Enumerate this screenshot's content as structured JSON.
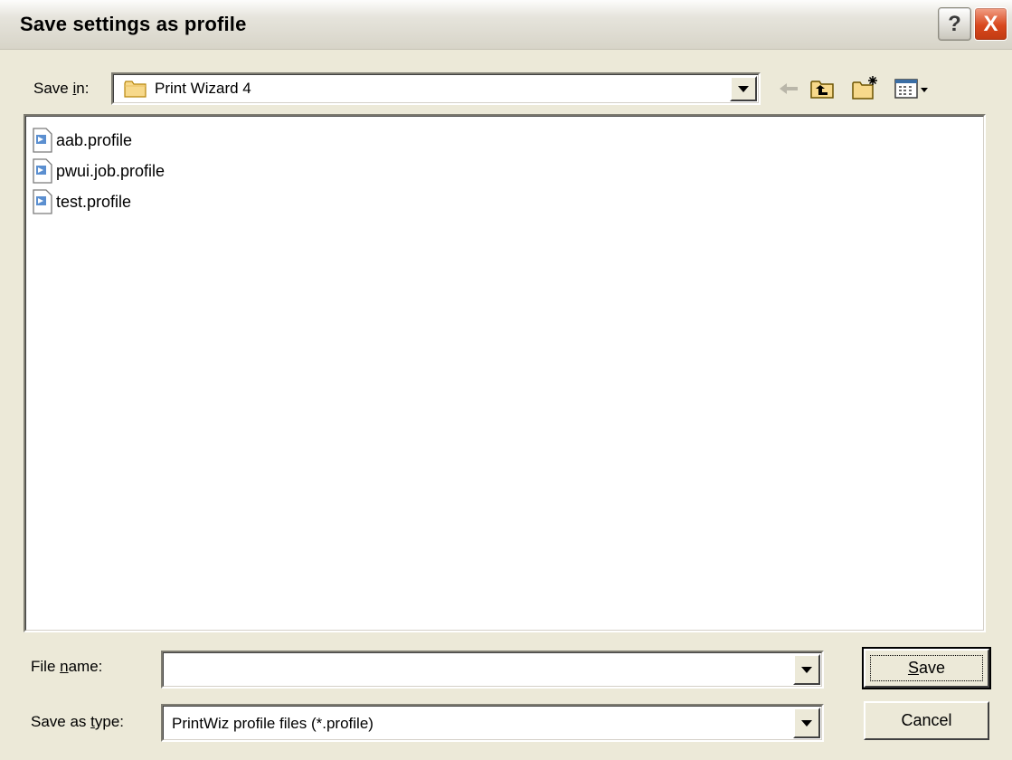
{
  "dialog": {
    "title": "Save settings as profile",
    "help_glyph": "?",
    "close_glyph": "X"
  },
  "save_in": {
    "label_prefix": "Save ",
    "label_accel": "i",
    "label_suffix": "n:",
    "value": "Print Wizard 4",
    "folder_icon": "folder-icon"
  },
  "toolbar": {
    "back_icon": "back-arrow-icon",
    "up_icon": "up-one-level-icon",
    "new_folder_icon": "new-folder-icon",
    "view_icon": "view-menu-icon"
  },
  "files": [
    {
      "name": "aab.profile",
      "icon": "profile-file-icon"
    },
    {
      "name": "pwui.job.profile",
      "icon": "profile-file-icon"
    },
    {
      "name": "test.profile",
      "icon": "profile-file-icon"
    }
  ],
  "file_name": {
    "label_prefix": "File ",
    "label_accel": "n",
    "label_suffix": "ame:",
    "value": ""
  },
  "save_as_type": {
    "label_prefix": "Save as ",
    "label_accel": "t",
    "label_suffix": "ype:",
    "value": "PrintWiz profile files (*.profile)"
  },
  "buttons": {
    "save_accel": "S",
    "save_rest": "ave",
    "cancel": "Cancel"
  },
  "colors": {
    "dialog_bg": "#ECE9D8",
    "close_red": "#D9481E"
  }
}
